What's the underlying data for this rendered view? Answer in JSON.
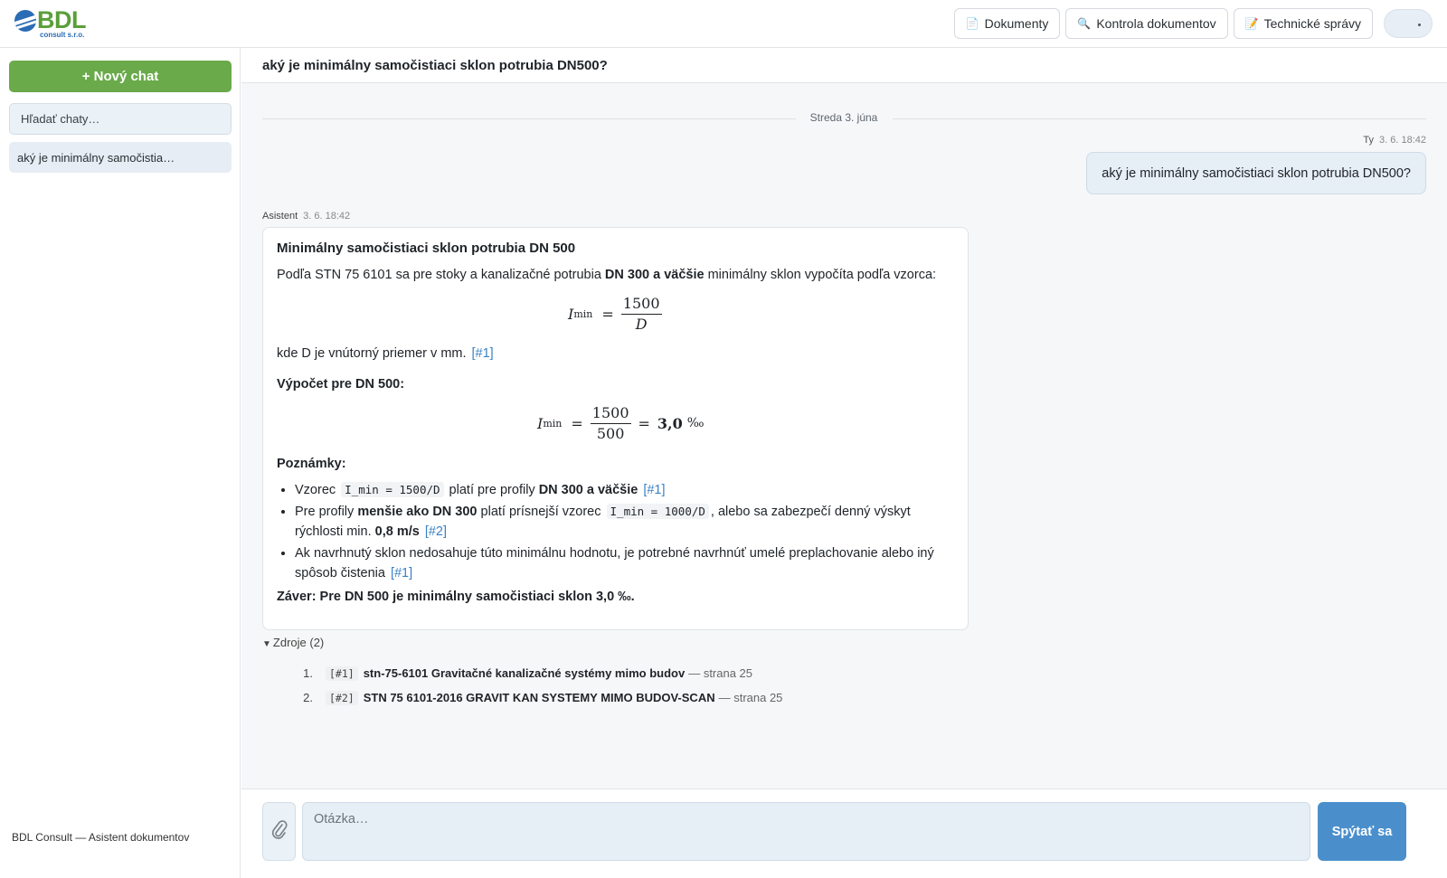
{
  "brand": {
    "name": "BDL",
    "sub": "consult s.r.o."
  },
  "topbar": {
    "buttons": [
      {
        "icon": "document-icon",
        "label": "Dokumenty"
      },
      {
        "icon": "magnifier-icon",
        "label": "Kontrola dokumentov"
      },
      {
        "icon": "memo-icon",
        "label": "Technické správy"
      }
    ]
  },
  "sidebar": {
    "new_chat": "+ Nový chat",
    "search_placeholder": "Hľadať chaty…",
    "chats": [
      "aký je minimálny samočistia…"
    ],
    "footer": "BDL Consult — Asistent dokumentov"
  },
  "chat": {
    "title": "aký je minimálny samočistiaci sklon potrubia DN500?",
    "date_separator": "Streda 3. júna",
    "user": {
      "author": "Ty",
      "time": "3. 6. 18:42",
      "text": "aký je minimálny samočistiaci sklon potrubia DN500?"
    },
    "assistant": {
      "author": "Asistent",
      "time": "3. 6. 18:42",
      "heading": "Minimálny samočistiaci sklon potrubia DN 500",
      "intro_pre": "Podľa STN 75 6101 sa pre stoky a kanalizačné potrubia ",
      "intro_bold": "DN 300 a väčšie",
      "intro_post": " minimálny sklon vypočíta podľa vzorca:",
      "formula1": {
        "lhs": "I",
        "sub": "min",
        "num": "1500",
        "den": "D"
      },
      "where_text": "kde D je vnútorný priemer v mm.",
      "where_ref": "[#1]",
      "calc_heading": "Výpočet pre DN 500:",
      "formula2": {
        "lhs": "I",
        "sub": "min",
        "num": "1500",
        "den": "500",
        "result": "3,0",
        "unit": "‰"
      },
      "notes_heading": "Poznámky:",
      "notes": {
        "n1_pre": "Vzorec ",
        "n1_code": "I_min = 1500/D",
        "n1_mid": " platí pre profily ",
        "n1_bold": "DN 300 a väčšie",
        "n1_ref": "[#1]",
        "n2_pre": "Pre profily ",
        "n2_bold": "menšie ako DN 300",
        "n2_mid": " platí prísnejší vzorec ",
        "n2_code": "I_min = 1000/D",
        "n2_post": ", alebo sa zabezpečí denný výskyt rýchlosti min. ",
        "n2_bold2": "0,8 m/s",
        "n2_ref": "[#2]",
        "n3_text": "Ak navrhnutý sklon nedosahuje túto minimálnu hodnotu, je potrebné navrhnúť umelé preplachovanie alebo iný spôsob čistenia",
        "n3_ref": "[#1]"
      },
      "conclusion": "Záver: Pre DN 500 je minimálny samočistiaci sklon 3,0 ‰."
    },
    "sources_label": "Zdroje (2)",
    "sources": [
      {
        "num": "1.",
        "tag": "[#1]",
        "title": "stn-75-6101 Gravitačné kanalizačné systémy mimo budov",
        "page": "— strana 25"
      },
      {
        "num": "2.",
        "tag": "[#2]",
        "title": "STN 75 6101-2016 GRAVIT KAN SYSTEMY MIMO BUDOV-SCAN",
        "page": "— strana 25"
      }
    ]
  },
  "composer": {
    "placeholder": "Otázka…",
    "ask_label": "Spýtať sa"
  }
}
